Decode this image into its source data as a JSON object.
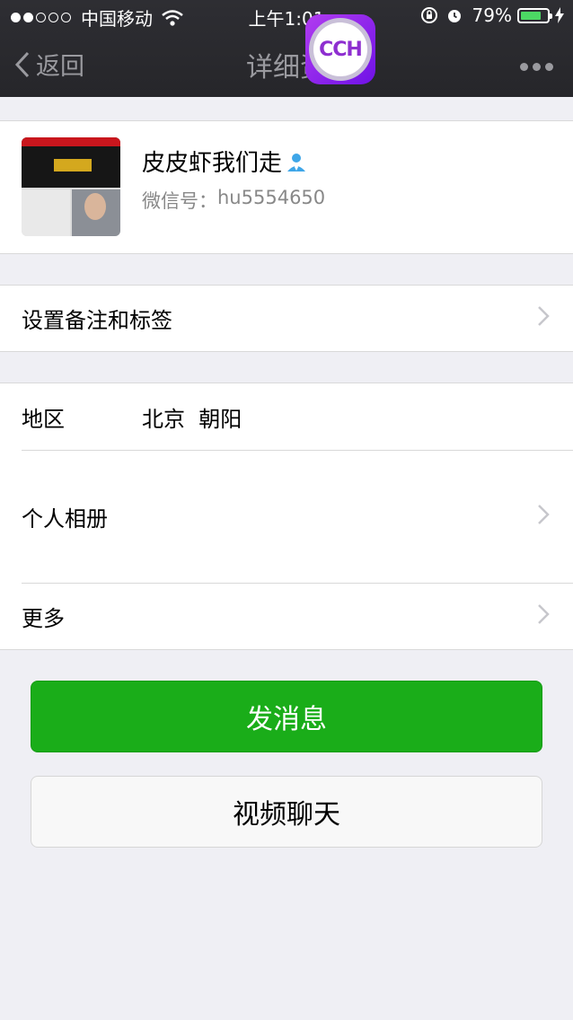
{
  "status_bar": {
    "carrier": "中国移动",
    "time": "上午1:01",
    "battery": "79%",
    "battery_level": 0.79,
    "signal_filled": 2,
    "signal_total": 5
  },
  "nav": {
    "back_label": "返回",
    "title": "详细资",
    "badge_text": "CCH"
  },
  "profile": {
    "name": "皮皮虾我们走",
    "wechat_label": "微信号：",
    "wechat_id": "hu5554650"
  },
  "rows": {
    "tags_label": "设置备注和标签",
    "region_label": "地区",
    "region_value": "北京  朝阳",
    "album_label": "个人相册",
    "more_label": "更多"
  },
  "buttons": {
    "message": "发消息",
    "video": "视频聊天"
  },
  "colors": {
    "header_bg": "#2a2a2e",
    "page_bg": "#efeff4",
    "primary_green": "#1aad19",
    "battery_green": "#4cd964",
    "badge_purple": "#8e2fd0",
    "contact_icon_blue": "#3ea6e8"
  },
  "icons": [
    "wifi-icon",
    "rotation-lock-icon",
    "alarm-icon",
    "charging-icon",
    "chevron-left-icon",
    "more-dots-icon",
    "contact-person-icon",
    "chevron-right-icon"
  ]
}
